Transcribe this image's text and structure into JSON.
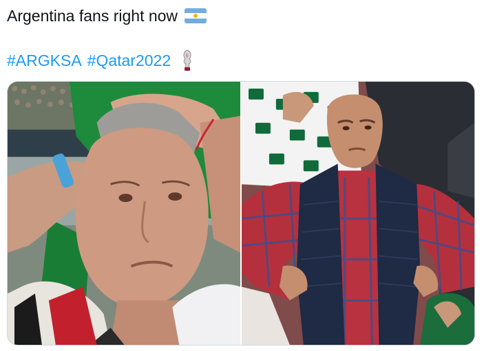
{
  "tweet": {
    "line1": "Argentina fans right now",
    "hashtag1": "#ARGKSA",
    "hashtag2": "#Qatar2022"
  },
  "icons": {
    "flag": "argentina-flag-emoji",
    "trophy": "world-cup-trophy-emoji"
  },
  "colors": {
    "text": "#0f1419",
    "link": "#1d9bf0",
    "saudi_green": "#1e8a3c",
    "pakistan_green": "#0f6b3a",
    "vest_navy": "#1f2a44",
    "shirt_red": "#b5303d"
  }
}
